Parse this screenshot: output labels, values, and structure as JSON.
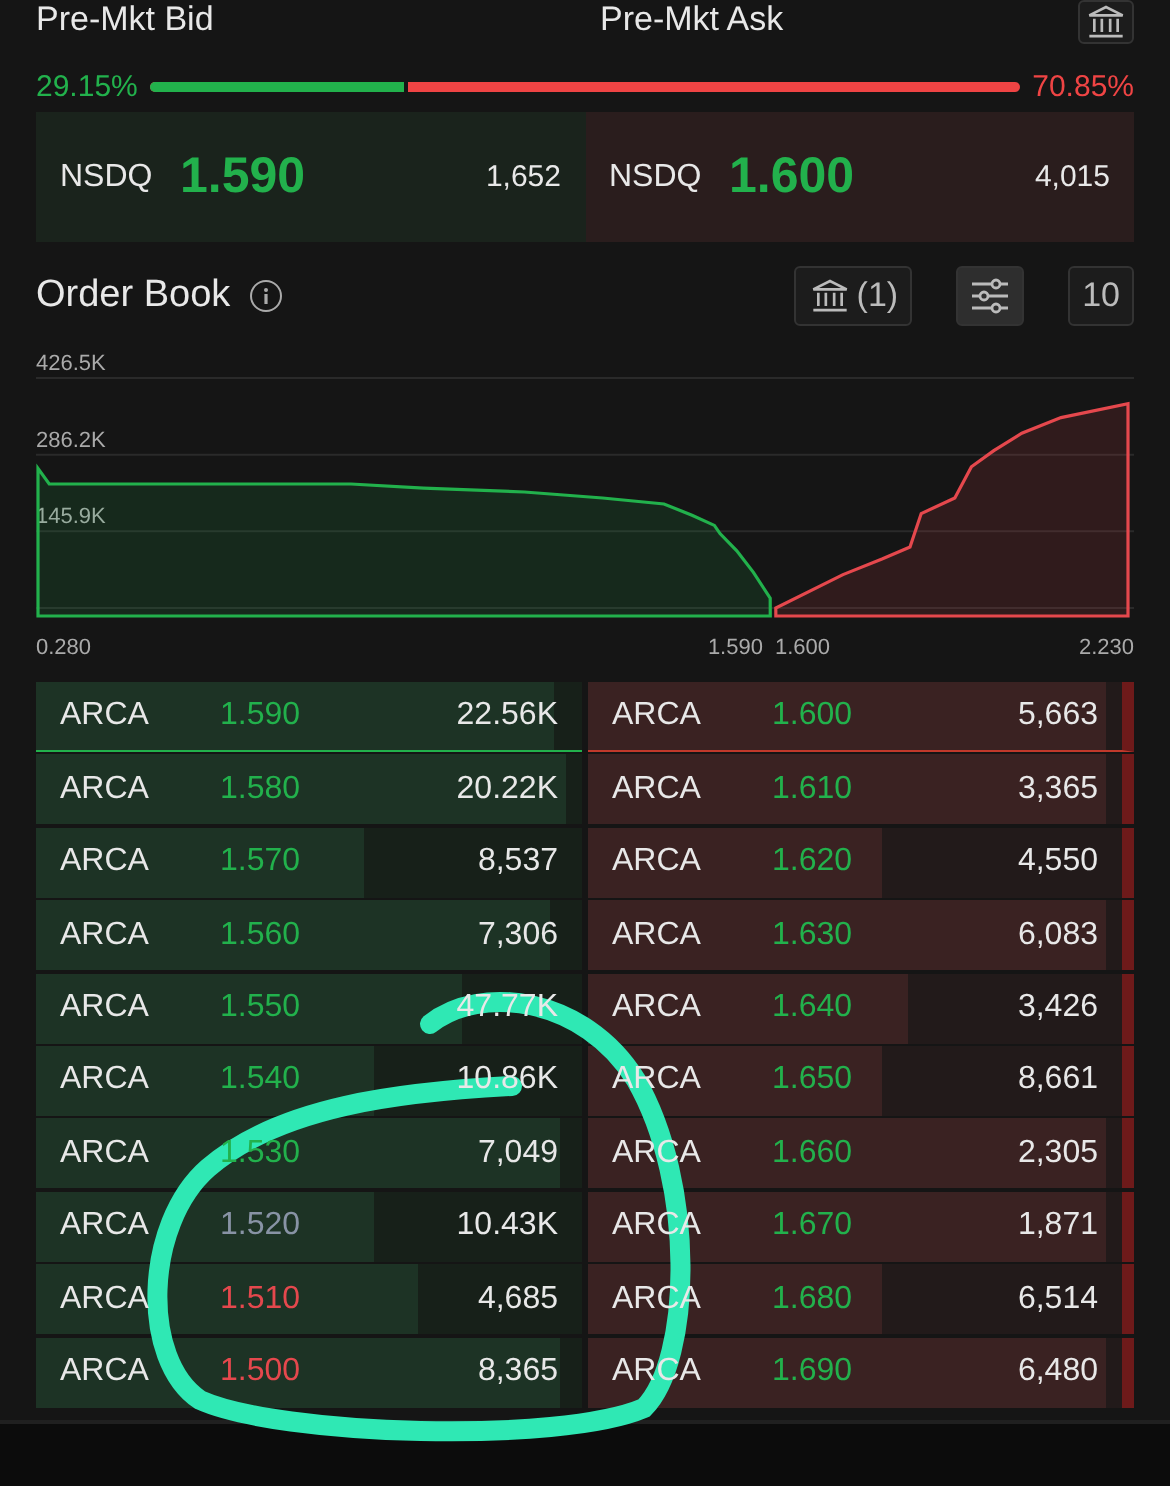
{
  "header": {
    "bid_label": "Pre-Mkt Bid",
    "ask_label": "Pre-Mkt Ask"
  },
  "ratio": {
    "bid_percent": "29.15%",
    "ask_percent": "70.85%",
    "level": 0.2915
  },
  "quote": {
    "bid": {
      "exchange": "NSDQ",
      "price": "1.590",
      "size": "1,652"
    },
    "ask": {
      "exchange": "NSDQ",
      "price": "1.600",
      "size": "4,015"
    }
  },
  "order_book": {
    "title": "Order Book",
    "exchange_filter": "(1)",
    "depth_button": "10"
  },
  "chart": {
    "kind": "depth",
    "volume_labels": [
      "426.5K",
      "286.2K",
      "145.9K"
    ],
    "price_labels": [
      "0.280",
      "1.590",
      "1.600",
      "2.230"
    ]
  },
  "bids": [
    {
      "exchange": "ARCA",
      "price": "1.590",
      "size": "22.56K",
      "color": "#22b14c",
      "level": 0.95
    },
    {
      "exchange": "ARCA",
      "price": "1.580",
      "size": "20.22K",
      "color": "#22b14c",
      "level": 0.97
    },
    {
      "exchange": "ARCA",
      "price": "1.570",
      "size": "8,537",
      "color": "#22b14c",
      "level": 0.6
    },
    {
      "exchange": "ARCA",
      "price": "1.560",
      "size": "7,306",
      "color": "#22b14c",
      "level": 0.94
    },
    {
      "exchange": "ARCA",
      "price": "1.550",
      "size": "47.77K",
      "color": "#22b14c",
      "level": 0.78
    },
    {
      "exchange": "ARCA",
      "price": "1.540",
      "size": "10.86K",
      "color": "#22b14c",
      "level": 0.62
    },
    {
      "exchange": "ARCA",
      "price": "1.530",
      "size": "7,049",
      "color": "#22b14c",
      "level": 0.96
    },
    {
      "exchange": "ARCA",
      "price": "1.520",
      "size": "10.43K",
      "color": "#8893a5",
      "level": 0.62
    },
    {
      "exchange": "ARCA",
      "price": "1.510",
      "size": "4,685",
      "color": "#e5484d",
      "level": 0.7
    },
    {
      "exchange": "ARCA",
      "price": "1.500",
      "size": "8,365",
      "color": "#e5484d",
      "level": 0.96
    }
  ],
  "asks": [
    {
      "exchange": "ARCA",
      "price": "1.600",
      "size": "5,663",
      "level": 0.97
    },
    {
      "exchange": "ARCA",
      "price": "1.610",
      "size": "3,365",
      "level": 0.97
    },
    {
      "exchange": "ARCA",
      "price": "1.620",
      "size": "4,550",
      "level": 0.55
    },
    {
      "exchange": "ARCA",
      "price": "1.630",
      "size": "6,083",
      "level": 0.97
    },
    {
      "exchange": "ARCA",
      "price": "1.640",
      "size": "3,426",
      "level": 0.6
    },
    {
      "exchange": "ARCA",
      "price": "1.650",
      "size": "8,661",
      "level": 0.55
    },
    {
      "exchange": "ARCA",
      "price": "1.660",
      "size": "2,305",
      "level": 0.97
    },
    {
      "exchange": "ARCA",
      "price": "1.670",
      "size": "1,871",
      "level": 0.97
    },
    {
      "exchange": "ARCA",
      "price": "1.680",
      "size": "6,514",
      "level": 0.55
    },
    {
      "exchange": "ARCA",
      "price": "1.690",
      "size": "6,480",
      "level": 0.97
    }
  ],
  "annotation": {
    "kind": "circle"
  }
}
